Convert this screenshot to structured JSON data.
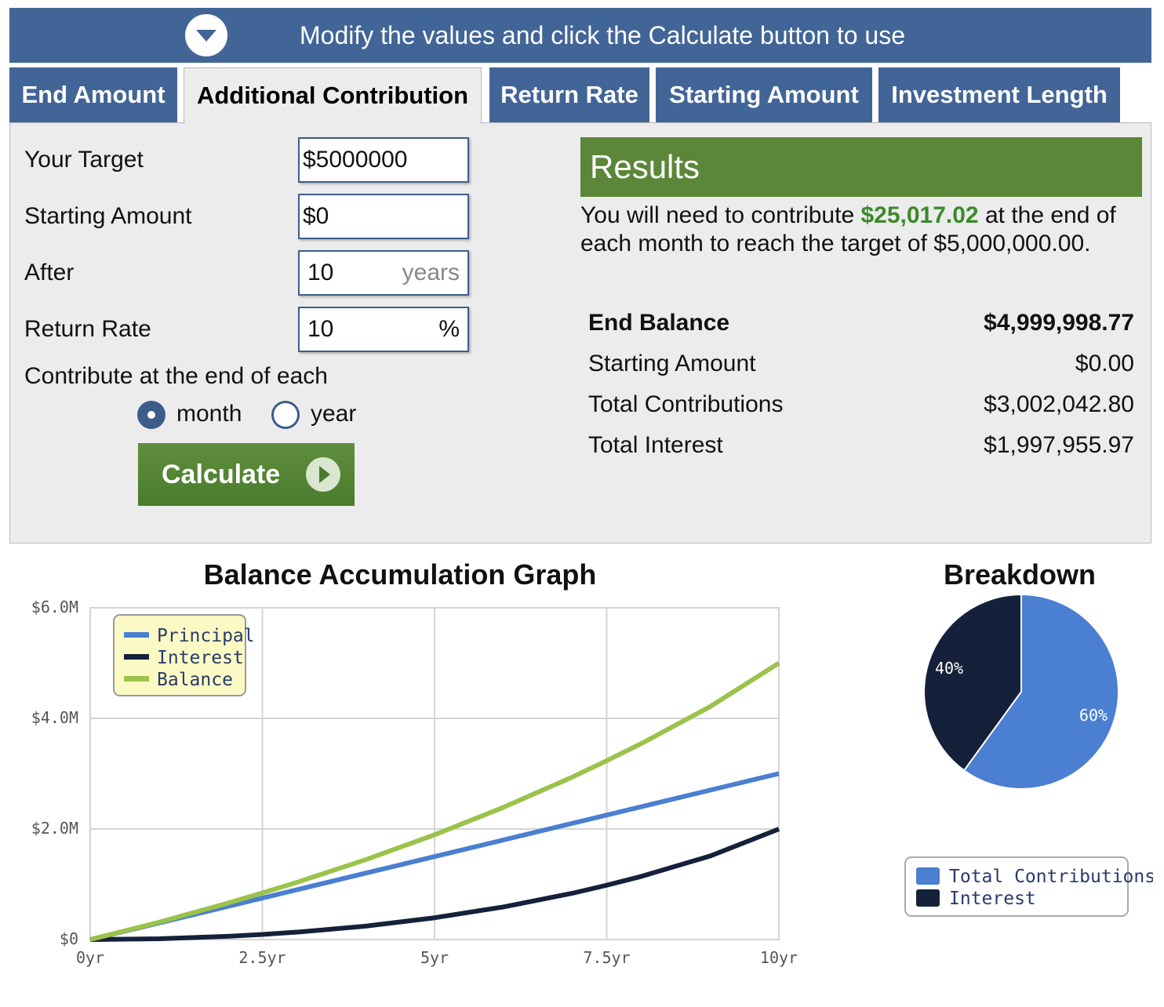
{
  "banner": {
    "text": "Modify the values and click the Calculate button to use",
    "toggle_icon": "chevron-down-icon"
  },
  "tabs": [
    {
      "label": "End Amount",
      "active": false
    },
    {
      "label": "Additional Contribution",
      "active": true
    },
    {
      "label": "Return Rate",
      "active": false
    },
    {
      "label": "Starting Amount",
      "active": false
    },
    {
      "label": "Investment Length",
      "active": false
    }
  ],
  "form": {
    "target_label": "Your Target",
    "target_value": "$5000000",
    "starting_label": "Starting Amount",
    "starting_value": "$0",
    "after_label": "After",
    "after_value": "10",
    "after_unit": "years",
    "rate_label": "Return Rate",
    "rate_value": "10",
    "rate_unit": "%",
    "contribute_label": "Contribute at the end of each",
    "option_month": "month",
    "option_year": "year",
    "selected": "month",
    "calculate_label": "Calculate"
  },
  "results": {
    "title": "Results",
    "sentence_pre": "You will need to contribute ",
    "contribution": "$25,017.02",
    "sentence_post": " at the end of each month to reach the target of $5,000,000.00.",
    "rows": [
      {
        "label": "End Balance",
        "value": "$4,999,998.77"
      },
      {
        "label": "Starting Amount",
        "value": "$0.00"
      },
      {
        "label": "Total Contributions",
        "value": "$3,002,042.80"
      },
      {
        "label": "Total Interest",
        "value": "$1,997,955.97"
      }
    ]
  },
  "colors": {
    "header_blue": "#426597",
    "green": "#5c8638",
    "principal": "#4a7fd1",
    "interest": "#15213a",
    "balance": "#9bc24a"
  },
  "chart_data": [
    {
      "type": "line",
      "title": "Balance Accumulation Graph",
      "x": [
        0,
        1,
        2,
        2.5,
        3,
        4,
        5,
        6,
        7,
        7.5,
        8,
        9,
        10
      ],
      "x_ticks": [
        "0yr",
        "2.5yr",
        "5yr",
        "7.5yr",
        "10yr"
      ],
      "y_ticks": [
        "$0",
        "$2.0M",
        "$4.0M",
        "$6.0M"
      ],
      "ylim": [
        0,
        6000000
      ],
      "xlim": [
        0,
        10
      ],
      "grid": true,
      "legend_position": "top-left",
      "series": [
        {
          "name": "Principal",
          "color": "#4a7fd1",
          "values": [
            0,
            300204,
            600408,
            750510,
            900613,
            1200817,
            1501021,
            1801226,
            2101430,
            2251532,
            2401634,
            2701839,
            3002043
          ]
        },
        {
          "name": "Interest",
          "color": "#15213a",
          "values": [
            0,
            14000,
            59000,
            93000,
            134000,
            243000,
            394000,
            590000,
            837000,
            983000,
            1141000,
            1510000,
            1997956
          ]
        },
        {
          "name": "Balance",
          "color": "#9bc24a",
          "values": [
            0,
            314204,
            659408,
            843510,
            1034613,
            1443817,
            1895021,
            2391226,
            2938430,
            3234532,
            3542634,
            4211839,
            4999999
          ]
        }
      ]
    },
    {
      "type": "pie",
      "title": "Breakdown",
      "legend_position": "bottom-right",
      "slices": [
        {
          "name": "Total Contributions",
          "value": 60,
          "label": "60%",
          "color": "#4a7fd1"
        },
        {
          "name": "Interest",
          "value": 40,
          "label": "40%",
          "color": "#15213a"
        }
      ]
    }
  ]
}
